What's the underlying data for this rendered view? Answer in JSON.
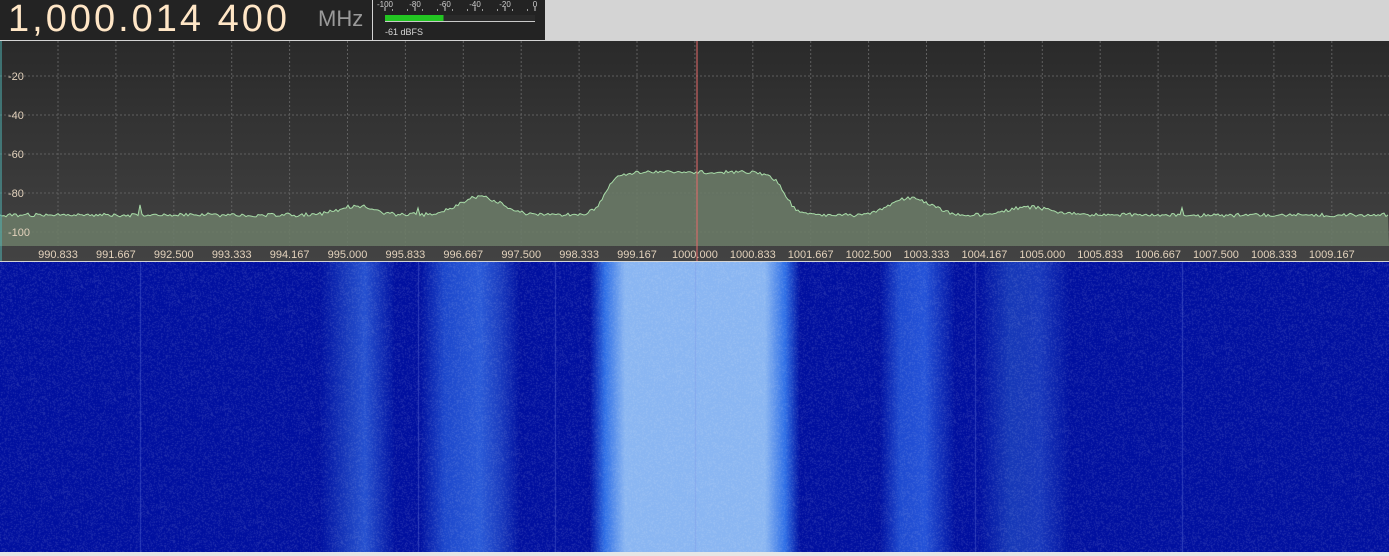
{
  "frequency": {
    "digits": "1,000.014 400",
    "unit": "MHz"
  },
  "signal_meter": {
    "scale_labels": [
      "-100",
      "-80",
      "-60",
      "-40",
      "-20",
      "0"
    ],
    "scale_range": [
      -100,
      0
    ],
    "level_dbfs": -61,
    "level_text": "-61 dBFS",
    "bar_color": "#22c522"
  },
  "panadapter": {
    "db_labels": [
      "-20",
      "-40",
      "-60",
      "-80",
      "-100"
    ],
    "freq_labels": [
      "990.833",
      "991.667",
      "992.500",
      "993.333",
      "994.167",
      "995.000",
      "995.833",
      "996.667",
      "997.500",
      "998.333",
      "999.167",
      "1000.000",
      "1000.833",
      "1001.667",
      "1002.500",
      "1003.333",
      "1004.167",
      "1005.000",
      "1005.833",
      "1006.667",
      "1007.500",
      "1008.333",
      "1009.167"
    ],
    "center_freq_mhz": 1000.0,
    "span_khz": [
      990.0,
      1010.0
    ],
    "db_range": [
      -10,
      -112
    ],
    "trace_color": "#a8dca8",
    "fill_color": "#6c7d69",
    "label_color": "#e3d2bc",
    "center_line_color": "#e86a6a"
  },
  "waterfall": {
    "background_color": "#0010a0",
    "band_color": "#2f6fe6",
    "peak_color": "#8ab6f2"
  }
}
